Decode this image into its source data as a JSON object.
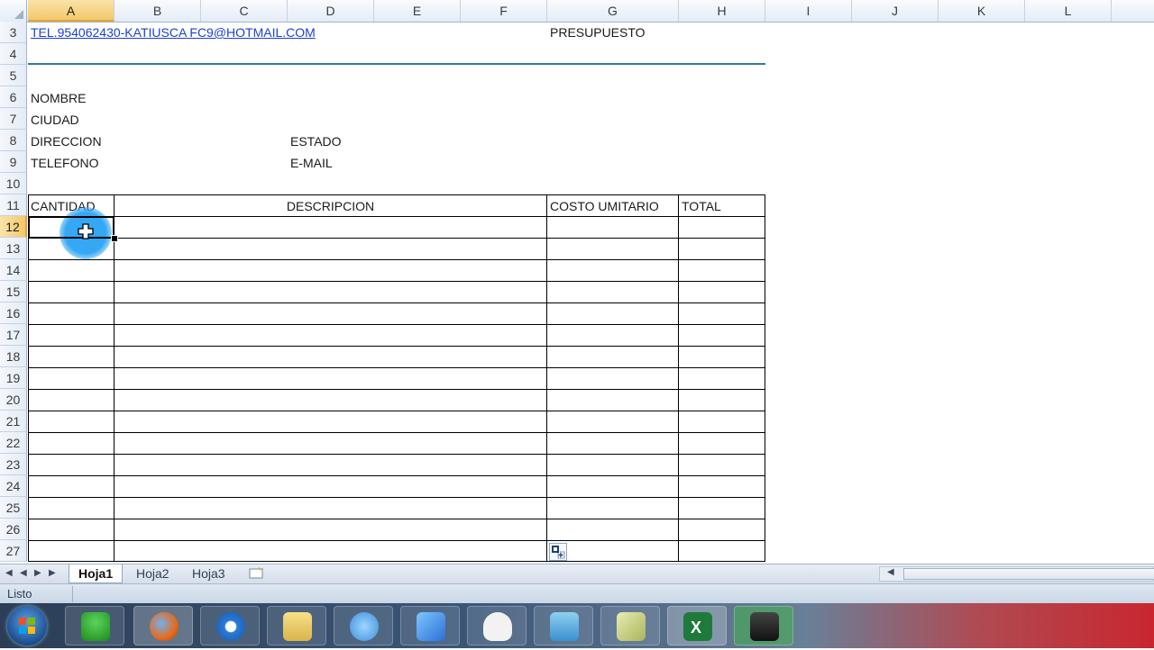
{
  "columns": [
    "A",
    "B",
    "C",
    "D",
    "E",
    "F",
    "G",
    "H",
    "I",
    "J",
    "K",
    "L"
  ],
  "selected_column": "A",
  "rows": [
    "3",
    "4",
    "5",
    "6",
    "7",
    "8",
    "9",
    "10",
    "11",
    "12",
    "13",
    "14",
    "15",
    "16",
    "17",
    "18",
    "19",
    "20",
    "21",
    "22",
    "23",
    "24",
    "25",
    "26",
    "27"
  ],
  "selected_row": "12",
  "cells": {
    "a3": "TEL.954062430-KATIUSCA  FC9@HOTMAIL.COM",
    "g3": "PRESUPUESTO",
    "a6": "NOMBRE",
    "a7": "CIUDAD",
    "a8": "DIRECCION",
    "d8": "ESTADO",
    "a9": "TELEFONO",
    "d9": "E-MAIL"
  },
  "table_headers": {
    "cantidad": "CANTIDAD",
    "descripcion": "DESCRIPCION",
    "costo": "COSTO UMITARIO",
    "total": "TOTAL"
  },
  "sheet_tabs": [
    "Hoja1",
    "Hoja2",
    "Hoja3"
  ],
  "active_tab": "Hoja1",
  "status": "Listo",
  "colors": {
    "selection": "#f4c86a",
    "accent_line": "#2e7e95",
    "link": "#1b3fd6",
    "click_highlight": "#35a8f5"
  },
  "taskbar_apps": [
    "mario-mushroom",
    "firefox",
    "internet-explorer",
    "file-explorer",
    "messenger",
    "butterfly",
    "ghost",
    "book",
    "notes",
    "excel",
    "camcorder"
  ]
}
